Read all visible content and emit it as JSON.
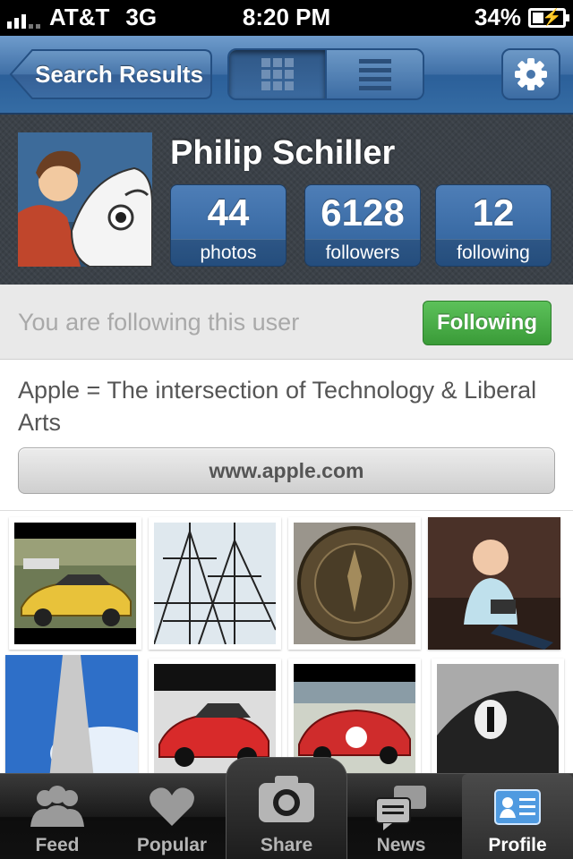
{
  "status_bar": {
    "carrier": "AT&T",
    "network": "3G",
    "time": "8:20 PM",
    "battery_percent": "34%",
    "battery_level": 0.34,
    "charging": true
  },
  "navbar": {
    "back_label": "Search Results",
    "view_modes": [
      "grid-icon",
      "list-icon"
    ],
    "active_view": "list",
    "settings_icon": "gear-icon"
  },
  "profile": {
    "name": "Philip Schiller",
    "stats": [
      {
        "value": "44",
        "label": "photos"
      },
      {
        "value": "6128",
        "label": "followers"
      },
      {
        "value": "12",
        "label": "following"
      }
    ]
  },
  "follow": {
    "status_text": "You are following this user",
    "button_label": "Following"
  },
  "bio": {
    "text": "Apple = The intersection of Technology & Liberal Arts",
    "website": "www.apple.com"
  },
  "photos": [
    {
      "subject": "yellow-sports-car"
    },
    {
      "subject": "ship-rigging"
    },
    {
      "subject": "freedom-trail-medallion"
    },
    {
      "subject": "child-on-couch"
    },
    {
      "subject": "monument-obelisk"
    },
    {
      "subject": "red-porsche"
    },
    {
      "subject": "red-ferrari"
    },
    {
      "subject": "race-car-number-1"
    }
  ],
  "tabbar": {
    "tabs": [
      {
        "label": "Feed",
        "icon": "people-icon"
      },
      {
        "label": "Popular",
        "icon": "heart-icon"
      },
      {
        "label": "Share",
        "icon": "camera-icon"
      },
      {
        "label": "News",
        "icon": "speech-bubbles-icon"
      },
      {
        "label": "Profile",
        "icon": "profile-card-icon"
      }
    ],
    "active": "Profile"
  },
  "colors": {
    "nav_blue": "#3f6fa6",
    "following_green": "#3a9b38",
    "stat_blue": "#2d5f99"
  }
}
